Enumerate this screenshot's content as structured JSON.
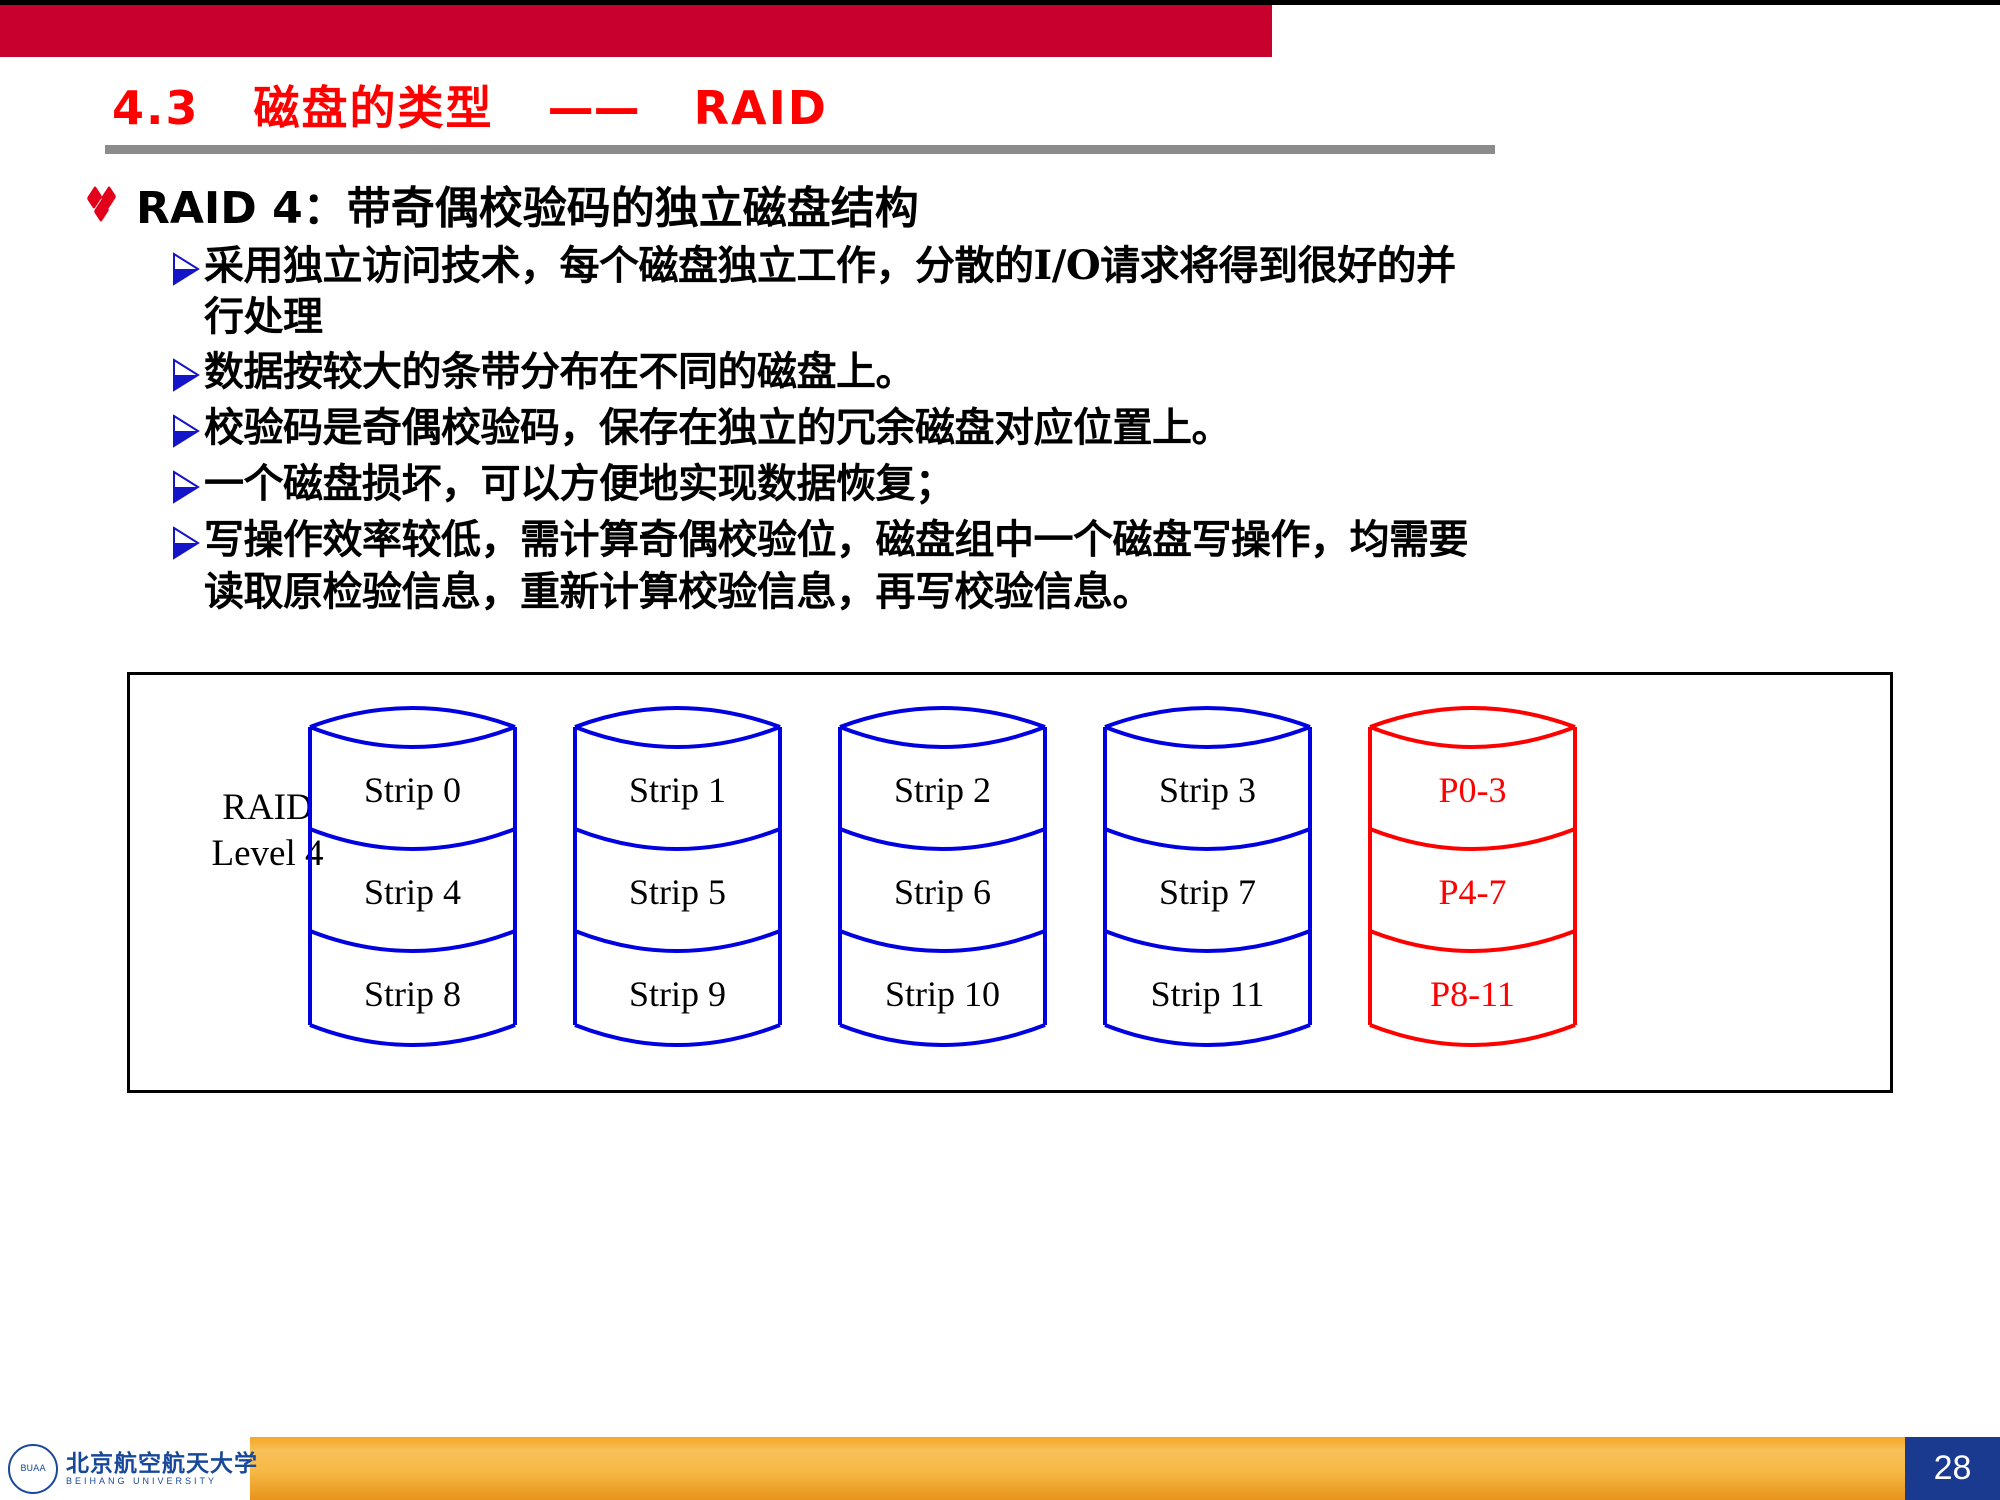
{
  "slide": {
    "title_number": "4.3",
    "title_main": "磁盘的类型",
    "title_dash": "——",
    "title_suffix": "RAID",
    "heading": "RAID 4：带奇偶校验码的独立磁盘结构",
    "bullets": [
      "采用独立访问技术，每个磁盘独立工作，分散的I/O请求将得到很好的并行处理",
      "数据按较大的条带分布在不同的磁盘上。",
      "校验码是奇偶校验码，保存在独立的冗余磁盘对应位置上。",
      "一个磁盘损坏，可以方便地实现数据恢复；",
      "写操作效率较低，需计算奇偶校验位，磁盘组中一个磁盘写操作，均需要读取原检验信息，重新计算校验信息，再写校验信息。"
    ],
    "page_number": "28"
  },
  "diagram": {
    "level_label_line1": "RAID",
    "level_label_line2": "Level 4",
    "disks": [
      {
        "kind": "data",
        "cells": [
          "Strip 0",
          "Strip 4",
          "Strip 8"
        ]
      },
      {
        "kind": "data",
        "cells": [
          "Strip 1",
          "Strip 5",
          "Strip 9"
        ]
      },
      {
        "kind": "data",
        "cells": [
          "Strip 2",
          "Strip 6",
          "Strip 10"
        ]
      },
      {
        "kind": "data",
        "cells": [
          "Strip 3",
          "Strip 7",
          "Strip 11"
        ]
      },
      {
        "kind": "parity",
        "cells": [
          "P0-3",
          "P4-7",
          "P8-11"
        ]
      }
    ]
  },
  "footer": {
    "university_cn": "北京航空航天大学",
    "university_en": "BEIHANG UNIVERSITY",
    "seal_text": "BUAA"
  },
  "colors": {
    "band_red": "#c8002d",
    "title_red": "#ff0000",
    "rule_gray": "#8c8c8c",
    "disk_blue": "#0000e0",
    "parity_red": "#ff0000",
    "footer_gold": "#f5a623",
    "page_navy": "#1a3a8f"
  }
}
